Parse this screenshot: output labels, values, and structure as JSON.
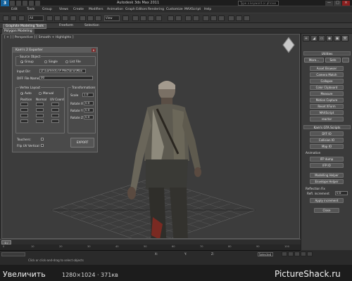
{
  "titlebar": {
    "app_logo": "3",
    "title": "Autodesk 3ds Max 2011",
    "search_placeholder": "Type a keyword or phrase",
    "window_buttons": [
      "—",
      "□",
      "×"
    ]
  },
  "menu": {
    "items": [
      "Edit",
      "Tools",
      "Group",
      "Views",
      "Create",
      "Modifiers",
      "Animation",
      "Graph Editors",
      "Rendering",
      "Customize",
      "MAXScript",
      "Help"
    ]
  },
  "toolbar": {
    "selection_filter": "All",
    "view_dropdown": "View"
  },
  "ribbon": {
    "tabs": [
      "Graphite Modeling Tools",
      "Freeform",
      "Selection"
    ],
    "sub_chip": "Polygon Modeling"
  },
  "viewport": {
    "label": "[ + ] [ Perspective ] [ Smooth + Highlights ]"
  },
  "dialog": {
    "title": "Kam's 2 Exporter",
    "close": "x",
    "source_group": "Source Object",
    "source_options": [
      {
        "label": "Group",
        "selected": true
      },
      {
        "label": "Single",
        "selected": false
      },
      {
        "label": "List File",
        "selected": false
      }
    ],
    "input_dir_label": "Input Dir:",
    "input_dir_value": "D:\\Games\\GTA Mechanix\\Max",
    "diff_file_label": "DIFF File Name:",
    "diff_file_value": "00",
    "vertex_group": "Vertex Layout",
    "vertex_options": [
      {
        "label": "Auto",
        "selected": true
      },
      {
        "label": "Manual",
        "selected": false
      }
    ],
    "vertex_cols": [
      "Position",
      "Normal",
      "UV Coord"
    ],
    "transform_group": "Transformations",
    "scale_label": "Scale",
    "scale_value": "1.0",
    "rotate_labels": [
      "Rotate X",
      "Rotate Y",
      "Rotate Z"
    ],
    "rotate_values": [
      "0.0",
      "0.0",
      "0.0"
    ],
    "touchers_label": "Touchers:",
    "flip_uv_label": "Flip UV Vertical",
    "export_button": "EXPORT"
  },
  "right_panel": {
    "tabs": [
      "+",
      "◢",
      "▭",
      "◉",
      "▣",
      "⚒"
    ],
    "utilities_header": "Utilities",
    "more_button": "More...",
    "sets_button": "Sets",
    "utility_buttons": [
      "Asset Browser",
      "Camera Match",
      "Collapse",
      "Color Clipboard",
      "Measure",
      "Motion Capture",
      "Reset XForm",
      "MAXScript",
      "reactor"
    ],
    "kams_header": "Kam's GTA Scripts",
    "kams_buttons": [
      "DFF IO",
      "Collision IO",
      "Map IO"
    ],
    "animation_label": "Animation",
    "anim_buttons": [
      "IFP dump",
      "IFP IO"
    ],
    "helper_buttons": [
      "Modelling Helper",
      "Envelope Helper"
    ],
    "reflection_label": "Reflection Fix",
    "refl_increment_label": "Refl. increment",
    "refl_increment_value": "0.0",
    "apply_button": "Apply increment",
    "close_button": "Close"
  },
  "timeline": {
    "slider": "0 / 100",
    "ticks": [
      "0",
      "10",
      "20",
      "30",
      "40",
      "50",
      "60",
      "70",
      "80",
      "90",
      "100"
    ]
  },
  "status": {
    "left_box": "",
    "x_label": "X:",
    "y_label": "Y:",
    "z_label": "Z:",
    "selected": "Selected",
    "hint": "Click or click-and-drag to select objects"
  },
  "watermark": {
    "zoom": "Увеличить",
    "size": "1280×1024 · 371кв",
    "site": "PictureShack.ru"
  }
}
